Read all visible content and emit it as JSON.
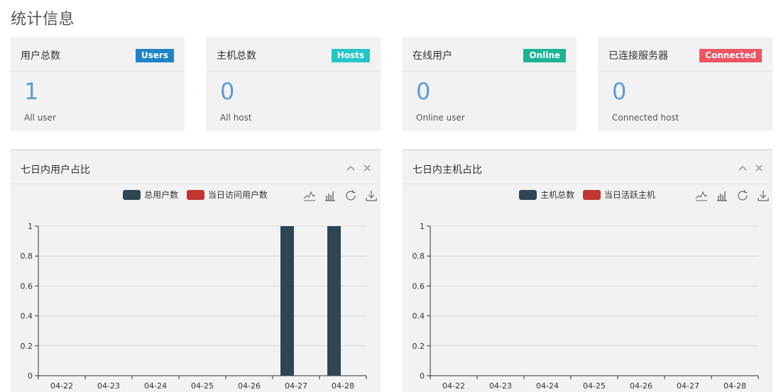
{
  "page": {
    "title": "统计信息"
  },
  "cards": [
    {
      "label": "用户总数",
      "badge": "Users",
      "badge_color": "#1f84c6",
      "value": "1",
      "sub": "All user"
    },
    {
      "label": "主机总数",
      "badge": "Hosts",
      "badge_color": "#23c6c8",
      "value": "0",
      "sub": "All host"
    },
    {
      "label": "在线用户",
      "badge": "Online",
      "badge_color": "#1ab394",
      "value": "0",
      "sub": "Online user"
    },
    {
      "label": "已连接服务器",
      "badge": "Connected",
      "badge_color": "#ed5565",
      "value": "0",
      "sub": "Connected host"
    }
  ],
  "panels": [
    {
      "title": "七日内用户占比",
      "collapse_icon": "chevron-up-icon",
      "close_icon": "close-icon",
      "legend": [
        "总用户数",
        "当日访问用户数"
      ]
    },
    {
      "title": "七日内主机占比",
      "collapse_icon": "chevron-up-icon",
      "close_icon": "close-icon",
      "legend": [
        "主机总数",
        "当日活跃主机"
      ]
    }
  ],
  "toolbox_icons": [
    "line-chart-icon",
    "bar-chart-icon",
    "refresh-icon",
    "download-icon"
  ],
  "chart_data": [
    {
      "type": "bar",
      "categories": [
        "04-22",
        "04-23",
        "04-24",
        "04-25",
        "04-26",
        "04-27",
        "04-28"
      ],
      "series": [
        {
          "name": "总用户数",
          "color": "#2f4554",
          "values": [
            0,
            0,
            0,
            0,
            0,
            1,
            1
          ]
        },
        {
          "name": "当日访问用户数",
          "color": "#c23531",
          "values": [
            0,
            0,
            0,
            0,
            0,
            0,
            0
          ]
        }
      ],
      "yticks": [
        "0",
        "0.2",
        "0.4",
        "0.6",
        "0.8",
        "1"
      ],
      "ylim": [
        0,
        1
      ],
      "grid": true,
      "legend_position": "top"
    },
    {
      "type": "bar",
      "categories": [
        "04-22",
        "04-23",
        "04-24",
        "04-25",
        "04-26",
        "04-27",
        "04-28"
      ],
      "series": [
        {
          "name": "主机总数",
          "color": "#2f4554",
          "values": [
            0,
            0,
            0,
            0,
            0,
            0,
            0
          ]
        },
        {
          "name": "当日活跃主机",
          "color": "#c23531",
          "values": [
            0,
            0,
            0,
            0,
            0,
            0,
            0
          ]
        }
      ],
      "yticks": [
        "0",
        "0.2",
        "0.4",
        "0.6",
        "0.8",
        "1"
      ],
      "ylim": [
        0,
        1
      ],
      "grid": true,
      "legend_position": "top"
    }
  ]
}
